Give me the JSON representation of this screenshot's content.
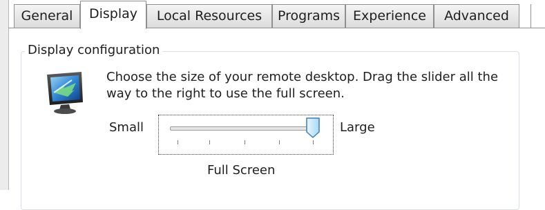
{
  "tabs": [
    {
      "label": "General"
    },
    {
      "label": "Display"
    },
    {
      "label": "Local Resources"
    },
    {
      "label": "Programs"
    },
    {
      "label": "Experience"
    },
    {
      "label": "Advanced"
    }
  ],
  "group": {
    "title": "Display configuration",
    "description": "Choose the size of your remote desktop. Drag the slider all the way to the right to use the full screen."
  },
  "slider": {
    "min_label": "Small",
    "max_label": "Large",
    "value_label": "Full Screen",
    "position": 1.0,
    "tick_count": 5
  },
  "colors": {
    "accent": "#4aa3df",
    "border": "#8e8f8f"
  }
}
